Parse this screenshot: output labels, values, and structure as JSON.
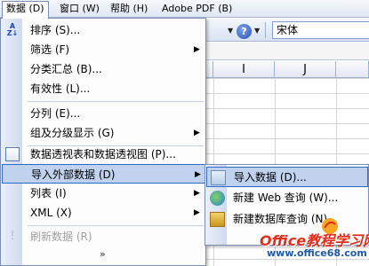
{
  "menubar": {
    "items": [
      {
        "label": "数据 (D)"
      },
      {
        "label": "窗口 (W)"
      },
      {
        "label": "帮助 (H)"
      },
      {
        "label": "Adobe PDF (B)"
      }
    ]
  },
  "toolbar": {
    "font_name": "宋体"
  },
  "spreadsheet": {
    "columns": [
      "I",
      "J"
    ]
  },
  "data_menu": {
    "items": [
      {
        "label": "排序 (S)...",
        "icon": "sort-az-icon"
      },
      {
        "label": "筛选 (F)"
      },
      {
        "label": "分类汇总 (B)..."
      },
      {
        "label": "有效性 (L)..."
      },
      {
        "label": "分列 (E)..."
      },
      {
        "label": "组及分级显示 (G)"
      },
      {
        "label": "数据透视表和数据透视图 (P)...",
        "icon": "pivot-table-icon"
      },
      {
        "label": "导入外部数据 (D)"
      },
      {
        "label": "列表 (I)"
      },
      {
        "label": "XML (X)"
      },
      {
        "label": "刷新数据 (R)",
        "icon": "refresh-icon"
      }
    ],
    "expand_glyph": "»"
  },
  "import_submenu": {
    "items": [
      {
        "label": "导入数据 (D)...",
        "icon": "import-data-icon"
      },
      {
        "label": "新建 Web 查询 (W)...",
        "icon": "web-query-icon"
      },
      {
        "label": "新建数据库查询 (N)...",
        "icon": "database-query-icon"
      }
    ]
  },
  "watermark": {
    "title": "Office教程学习网",
    "url": "www.office68.com"
  },
  "colors": {
    "highlight": "#c1d2ee",
    "highlight_border": "#316ac5",
    "watermark_red": "#e02f1e",
    "watermark_blue": "#1f5aa6"
  }
}
